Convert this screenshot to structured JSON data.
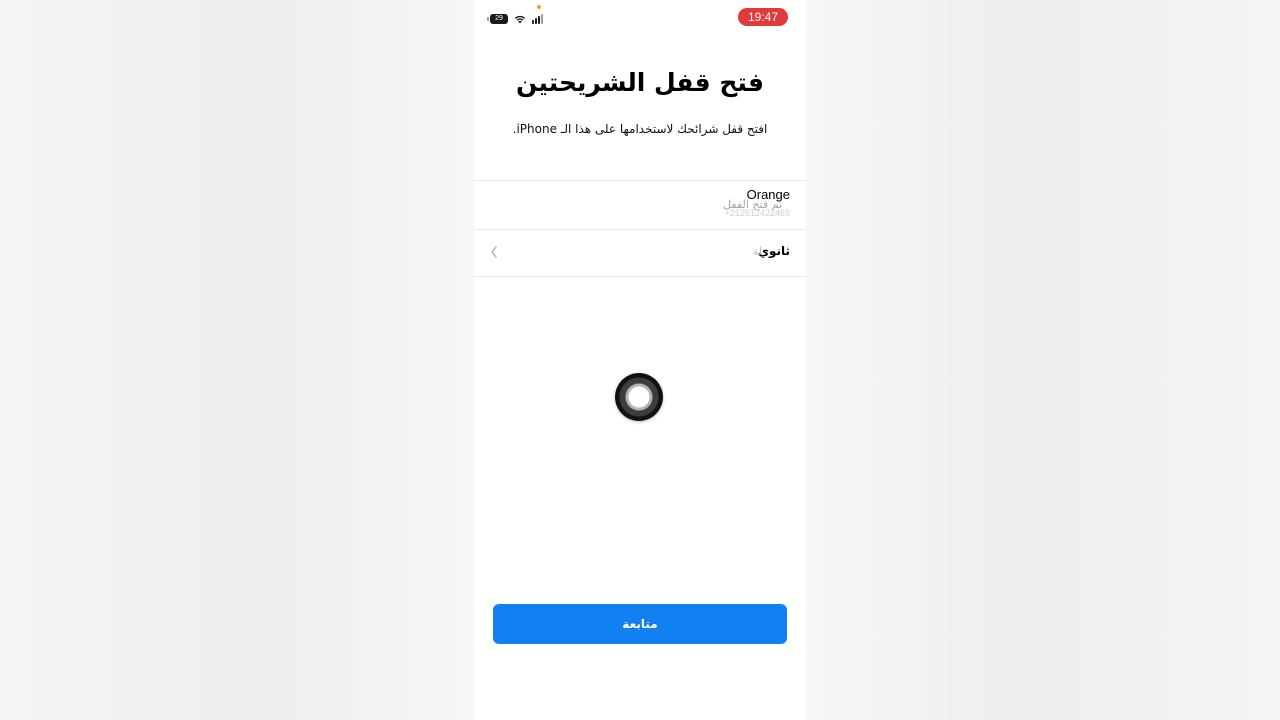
{
  "status_bar": {
    "time": "19:47",
    "battery": "29",
    "time_pill_color": "#e03a3a",
    "icons": [
      "battery-icon",
      "wifi-icon",
      "cellular-signal-icon"
    ]
  },
  "page": {
    "title": "فتح قفل الشريحتين",
    "subtitle": "افتح قفل شرائحك لاستخدامها على هذا الـ iPhone."
  },
  "sim_list": {
    "primary": {
      "carrier": "Orange",
      "status": "تم فتح القفل",
      "number": "+212612422469"
    },
    "secondary": {
      "label": "ثانوي",
      "ghost_text": "لة"
    }
  },
  "loading_indicator": "spinner",
  "actions": {
    "continue_label": "متابعة",
    "button_color": "#1280f0"
  }
}
